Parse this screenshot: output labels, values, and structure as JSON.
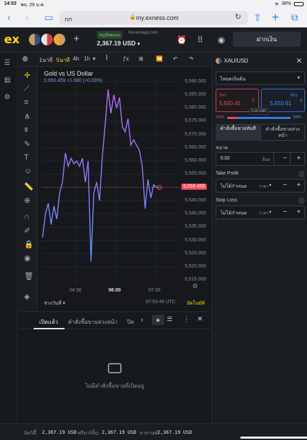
{
  "ios_status": {
    "time": "14:53",
    "date": "พฤ. 29 ม.ค.",
    "battery": "38%"
  },
  "browser": {
    "tab_label": "กก",
    "url": "my.exness.com"
  },
  "app": {
    "logo": "ex",
    "account_type": "บัญชีทดลอง",
    "server": "forexonapp.com",
    "balance": "2,367.19 USD",
    "deposit_label": "ฝากเงิน"
  },
  "toolbar": {
    "tf_1m": "1นาที",
    "tf_5m": "5นาที",
    "tf_4h": "4h",
    "tf_1h": "1h"
  },
  "chart": {
    "title": "Gold vs US Dollar",
    "subtitle": "5,550.459  +1.680 (+0.03%)",
    "current_price_label": "5,550.459",
    "range_label": "ช่วงวันที่",
    "time_readout": "07:53:49 UTC",
    "auto_label": "อัตโนมัติ"
  },
  "chart_data": {
    "type": "line",
    "title": "Gold vs US Dollar",
    "xlabel": "",
    "ylabel": "",
    "x_ticks": [
      "04:30",
      "06:00",
      "07:30"
    ],
    "y_ticks": [
      "5,590.000",
      "5,585.000",
      "5,580.000",
      "5,575.000",
      "5,570.000",
      "5,565.000",
      "5,560.000",
      "5,555.000",
      "5,550.000",
      "5,545.000",
      "5,540.000",
      "5,535.000",
      "5,530.000",
      "5,525.000",
      "5,520.000",
      "5,515.000"
    ],
    "ylim": [
      5513,
      5592
    ],
    "series": [
      {
        "values": [
          5531,
          5540,
          5544,
          5536,
          5543,
          5538,
          5548,
          5552,
          5563,
          5558,
          5561,
          5559,
          5560,
          5558,
          5561,
          5552,
          5560,
          5522,
          5548,
          5552,
          5545,
          5562,
          5574,
          5587,
          5578,
          5585,
          5580,
          5584,
          5573,
          5571,
          5576,
          5566,
          5568,
          5566,
          5564,
          5558,
          5542,
          5553,
          5546,
          5551,
          5550,
          5550
        ]
      }
    ]
  },
  "order_panel": {
    "symbol": "XAU/USD",
    "mode": "โหมดเริ่มต้น",
    "sell_label": "Sell",
    "sell_price": "5,550.45",
    "sell_sup": "9",
    "buy_label": "Buy",
    "buy_price": "5,550.61",
    "buy_sup": "9",
    "spread": "0.16 USD",
    "sentiment_sell": "16%",
    "sentiment_buy": "84%",
    "sentiment_buy_fraction": 0.84,
    "tab_market": "คำสั่งซื้อขายทันที",
    "tab_pending": "คำสั่งซื้อขายล่วงหน้า",
    "volume_label": "ขนาด",
    "volume_value": "0.02",
    "volume_unit": "ล็อต",
    "tp_label": "Take Profit",
    "tp_value": "ไม่ได้กำหนด",
    "tp_unit": "ราคา",
    "sl_label": "Stop Loss",
    "sl_value": "ไม่ได้กำหนด",
    "sl_unit": "ราคา"
  },
  "bottom": {
    "tab_open": "เปิดแล้ว",
    "tab_pending": "คำสั่งซื้อขายล่วงหน้า",
    "tab_closed": "ปิด",
    "empty_message": "ไม่มีคำสั่งซื้อขายที่เปิดอยู่"
  },
  "footer": {
    "equity_label": "อิควิตี้:",
    "equity_value": "2,367.19 USD",
    "free_margin_label": "ฟรีมาร์จิ้น:",
    "free_margin_value": "2,367.19 USD",
    "balance_label": "บาลานซ์:",
    "balance_value": "2,367.19 USD"
  },
  "colors": {
    "accent": "#ffde02",
    "sell": "#ef4a55",
    "buy": "#2f7cf6",
    "line_top": "#b566f0",
    "line_bottom": "#5d8df5"
  }
}
